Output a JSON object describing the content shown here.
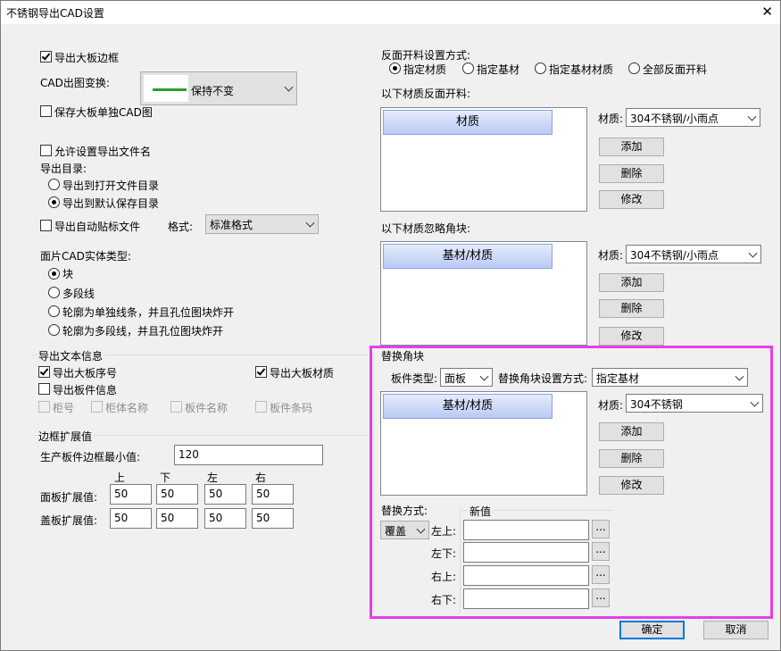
{
  "window": {
    "title": "不锈钢导出CAD设置",
    "close_glyph": "✕"
  },
  "left": {
    "export_frame": {
      "label": "导出大板边框",
      "checked": true
    },
    "cad_transform": {
      "label": "CAD出图变换:",
      "value": "保持不变",
      "line_color": "#2aa02a"
    },
    "save_separate": {
      "label": "保存大板单独CAD图",
      "checked": false
    },
    "allow_filename": {
      "label": "允许设置导出文件名",
      "checked": false
    },
    "export_dir": {
      "label": "导出目录:",
      "options": [
        "导出到打开文件目录",
        "导出到默认保存目录"
      ],
      "selected": 1
    },
    "auto_label": {
      "label": "导出自动贴标文件",
      "checked": false
    },
    "format": {
      "label": "格式:",
      "value": "标准格式"
    },
    "solid_type": {
      "label": "面片CAD实体类型:",
      "options": [
        "块",
        "多段线",
        "轮廓为单独线条，并且孔位图块炸开",
        "轮廓为多段线，并且孔位图块炸开"
      ],
      "selected": 0
    },
    "text_info": {
      "title": "导出文本信息",
      "board_no": {
        "label": "导出大板序号",
        "checked": true
      },
      "board_material": {
        "label": "导出大板材质",
        "checked": true
      },
      "part_info": {
        "label": "导出板件信息",
        "checked": false
      },
      "sub": [
        "柜号",
        "柜体名称",
        "板件名称",
        "板件条码"
      ]
    },
    "border": {
      "title": "边框扩展值",
      "min_label": "生产板件边框最小值:",
      "min_value": "120",
      "cols": [
        "上",
        "下",
        "左",
        "右"
      ],
      "rows": [
        {
          "label": "面板扩展值:",
          "values": [
            "50",
            "50",
            "50",
            "50"
          ]
        },
        {
          "label": "盖板扩展值:",
          "values": [
            "50",
            "50",
            "50",
            "50"
          ]
        }
      ]
    }
  },
  "right": {
    "reverse_mode": {
      "label": "反面开料设置方式:",
      "options": [
        "指定材质",
        "指定基材",
        "指定基材材质",
        "全部反面开料"
      ],
      "selected": 0
    },
    "reverse_list": {
      "label": "以下材质反面开料:",
      "header": "材质",
      "material_label": "材质:",
      "material_value": "304不锈钢/小雨点"
    },
    "ignore_list": {
      "label": "以下材质忽略角块:",
      "header": "基材/材质",
      "material_label": "材质:",
      "material_value": "304不锈钢/小雨点"
    },
    "buttons": {
      "add": "添加",
      "delete": "删除",
      "modify": "修改"
    },
    "replace": {
      "title": "替换角块",
      "part_type_label": "板件类型:",
      "part_type_value": "面板",
      "mode_label": "替换角块设置方式:",
      "mode_value": "指定基材",
      "list_header": "基材/材质",
      "material_label": "材质:",
      "material_value": "304不锈钢",
      "method_label": "替换方式:",
      "method_value": "覆盖",
      "new_value_title": "新值",
      "corners": [
        "左上:",
        "左下:",
        "右上:",
        "右下:"
      ],
      "dots": "..."
    }
  },
  "footer": {
    "ok": "确定",
    "cancel": "取消"
  },
  "highlight_color": "#e83ee8"
}
